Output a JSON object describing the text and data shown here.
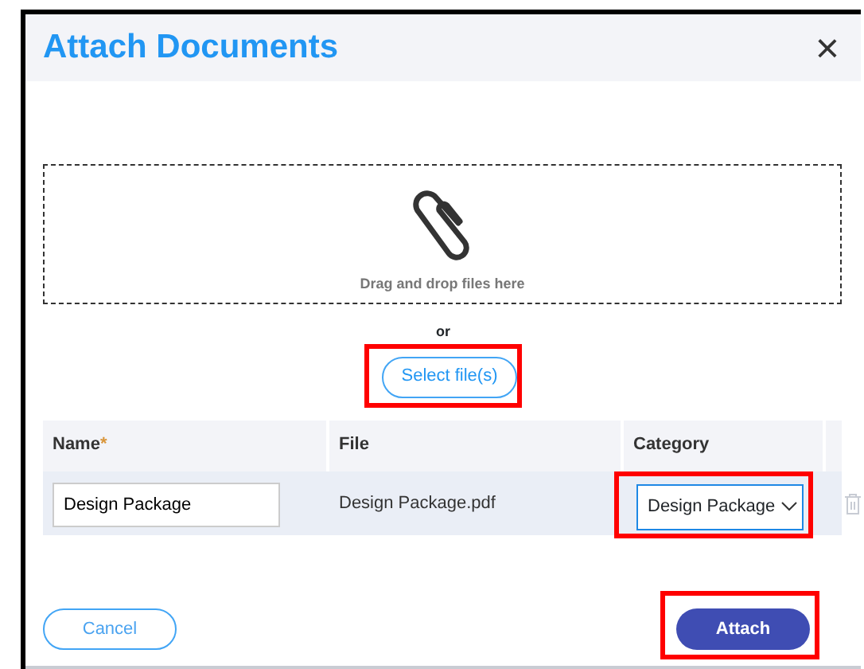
{
  "dialog": {
    "title": "Attach Documents",
    "close": "×"
  },
  "dropzone": {
    "text": "Drag and drop files here"
  },
  "separator": "or",
  "select_button": {
    "label": "Select file(s)",
    "highlighted": true
  },
  "table": {
    "columns": [
      {
        "label": "Name",
        "required_mark": "*"
      },
      {
        "label": "File"
      },
      {
        "label": "Category"
      }
    ],
    "rows": [
      {
        "name": "Design Package",
        "file": "Design Package.pdf",
        "category": "Design Package",
        "category_highlighted": true
      }
    ]
  },
  "buttons": [
    {
      "label": "Cancel",
      "kind": "secondary",
      "highlighted": false
    },
    {
      "label": "Attach",
      "kind": "primary",
      "highlighted": true
    }
  ]
}
